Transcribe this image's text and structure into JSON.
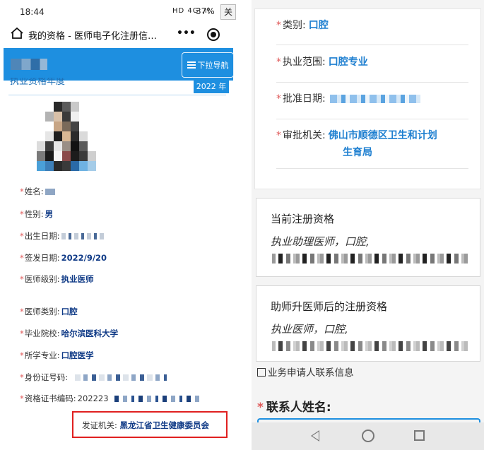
{
  "left": {
    "status": {
      "time": "18:44",
      "signal": "HD 4G .ıl",
      "battery": "37%",
      "close_label": "关"
    },
    "browser": {
      "title": "我的资格 - 医师电子化注册信…",
      "menu_label": "•••"
    },
    "header": {
      "nav_label": "下拉导航"
    },
    "card": {
      "tab_label": "执业资格年度",
      "year": "2022 年"
    },
    "fields": [
      {
        "label": "姓名:",
        "value": ""
      },
      {
        "label": "性别:",
        "value": "男"
      },
      {
        "label": "出生日期:",
        "value": ""
      },
      {
        "label": "签发日期:",
        "value": "2022/9/20"
      },
      {
        "label": "医师级别:",
        "value": "执业医师"
      },
      {
        "label": "医师类别:",
        "value": "口腔"
      },
      {
        "label": "毕业院校:",
        "value": "哈尔滨医科大学"
      },
      {
        "label": "所学专业:",
        "value": "口腔医学"
      },
      {
        "label": "身份证号码:",
        "value": ""
      },
      {
        "label": "资格证书编码:",
        "value": "202223"
      }
    ],
    "issuer": {
      "label": "发证机关:",
      "value": "黑龙江省卫生健康委员会"
    }
  },
  "right": {
    "rows": [
      {
        "label": "类别:",
        "value": "口腔"
      },
      {
        "label": "执业范围:",
        "value": "口腔专业"
      },
      {
        "label": "批准日期:",
        "value": ""
      },
      {
        "label": "审批机关:",
        "value": "佛山市顺德区卫生和计划",
        "value2": "生育局"
      }
    ],
    "panels": [
      {
        "title": "当前注册资格",
        "line": "执业助理医师，口腔,"
      },
      {
        "title": "助师升医师后的注册资格",
        "line": "执业医师，口腔,"
      }
    ],
    "biz_info": "业务申请人联系信息",
    "contact_label": "联系人姓名:",
    "colors": {
      "accent": "#1e8fe0",
      "value_text": "#0f3a86",
      "required_star": "#e05a5a",
      "highlight_box": "#e02020"
    }
  }
}
